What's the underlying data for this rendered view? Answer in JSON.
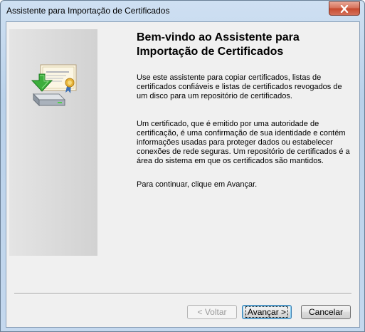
{
  "window": {
    "title": "Assistente para Importação de Certificados",
    "close_icon": "close-icon"
  },
  "left_panel": {
    "icon": "certificate-import-icon"
  },
  "content": {
    "heading": "Bem-vindo ao Assistente para Importação de Certificados",
    "paragraph1": "Use este assistente para copiar certificados, listas de certificados confiáveis e listas de certificados revogados de um disco para um repositório de certificados.",
    "paragraph2": "Um certificado, que é emitido por uma autoridade de certificação, é uma confirmação de sua identidade e contém informações usadas para proteger dados ou estabelecer conexões de rede seguras. Um repositório de certificados é a área do sistema em que os certificados são mantidos.",
    "paragraph3": "Para continuar, clique em Avançar."
  },
  "buttons": {
    "back": "< Voltar",
    "next": "Avançar >",
    "cancel": "Cancelar"
  }
}
